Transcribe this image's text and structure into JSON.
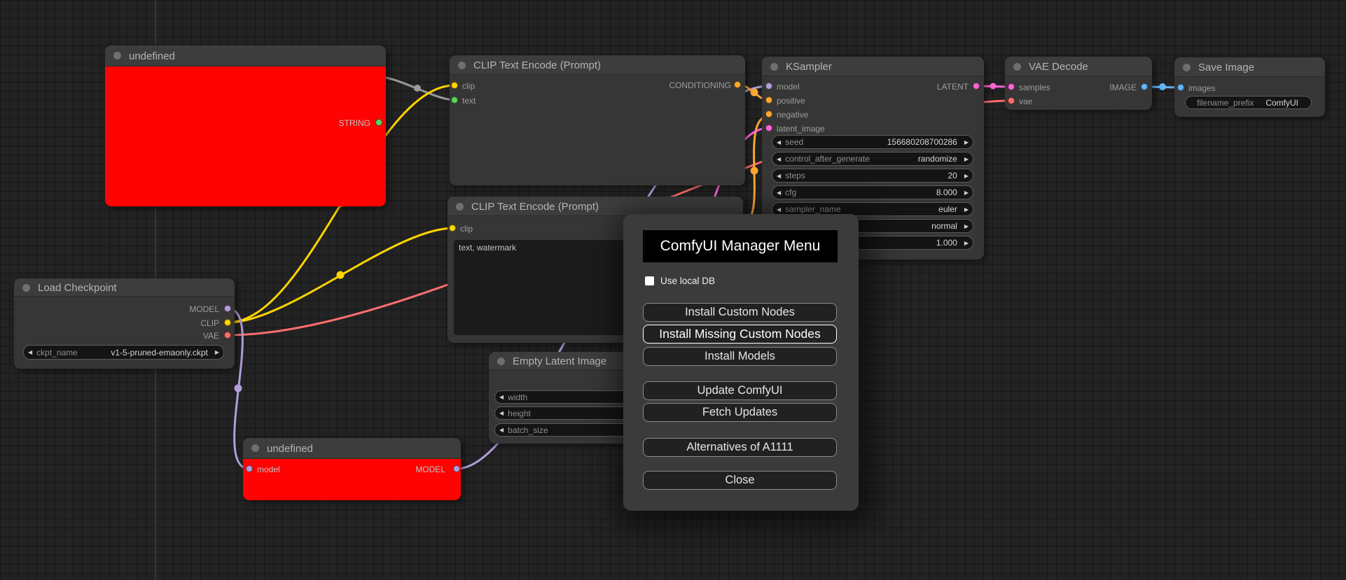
{
  "nodes": {
    "undefined_top": {
      "title": "undefined",
      "output": "STRING"
    },
    "clip1": {
      "title": "CLIP Text Encode (Prompt)",
      "inputs": [
        "clip",
        "text"
      ],
      "output": "CONDITIONING"
    },
    "ksampler": {
      "title": "KSampler",
      "inputs": [
        "model",
        "positive",
        "negative",
        "latent_image"
      ],
      "output": "LATENT",
      "widgets": [
        {
          "label": "seed",
          "value": "156680208700286"
        },
        {
          "label": "control_after_generate",
          "value": "randomize"
        },
        {
          "label": "steps",
          "value": "20"
        },
        {
          "label": "cfg",
          "value": "8.000"
        },
        {
          "label": "sampler_name",
          "value": "euler"
        },
        {
          "label": "",
          "value": "normal"
        },
        {
          "label": "",
          "value": "1.000"
        }
      ]
    },
    "vae_decode": {
      "title": "VAE Decode",
      "inputs": [
        "samples",
        "vae"
      ],
      "output": "IMAGE"
    },
    "save_image": {
      "title": "Save Image",
      "input": "images",
      "widget": {
        "label": "filename_prefix",
        "value": "ComfyUI"
      }
    },
    "clip2": {
      "title": "CLIP Text Encode (Prompt)",
      "input": "clip",
      "text": "text, watermark"
    },
    "empty_latent": {
      "title": "Empty Latent Image",
      "widgets": [
        "width",
        "height",
        "batch_size"
      ]
    },
    "undefined_bottom": {
      "title": "undefined",
      "input": "model",
      "output": "MODEL"
    },
    "load_checkpoint": {
      "title": "Load Checkpoint",
      "outputs": [
        "MODEL",
        "CLIP",
        "VAE"
      ],
      "widget": {
        "label": "ckpt_name",
        "value": "v1-5-pruned-emaonly.ckpt"
      }
    }
  },
  "dialog": {
    "title": "ComfyUI Manager Menu",
    "checkbox_label": "Use local DB",
    "checkbox_checked": false,
    "buttons": [
      "Install Custom Nodes",
      "Install Missing Custom Nodes",
      "Install Models",
      "Update ComfyUI",
      "Fetch Updates",
      "Alternatives of A1111",
      "Close"
    ],
    "highlighted_button": "Install Missing Custom Nodes"
  },
  "colors": {
    "model": "#B39DDB",
    "clip": "#FFD500",
    "vae": "#FF6E6E",
    "conditioning": "#FFA931",
    "latent": "#FF64D5",
    "image": "#64B5F6",
    "string_slot": "#5CD65C",
    "string_link": "#9A9A9A",
    "error_node": "#FF0202",
    "node_bg": "#363636",
    "canvas_bg": "#232323",
    "dialog_bg": "#3B3B3B"
  }
}
